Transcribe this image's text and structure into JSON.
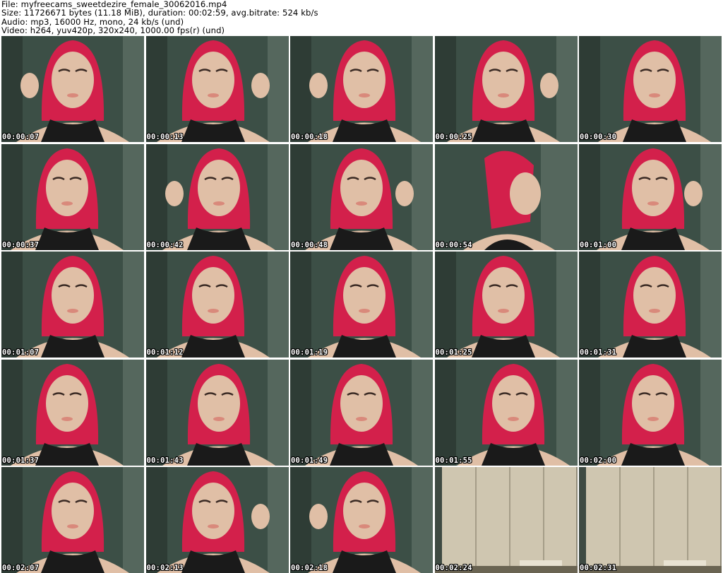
{
  "header": {
    "file_line": "File: myfreecams_sweetdezire_female_30062016.mp4",
    "size_line": "Size: 11726671 bytes (11.18 MiB), duration: 00:02:59, avg.bitrate: 524 kb/s",
    "audio_line": "Audio: mp3, 16000 Hz, mono, 24 kb/s (und)",
    "video_line": "Video: h264, yuv420p, 320x240, 1000.00 fps(r) (und)"
  },
  "colors": {
    "background": "#ffffff",
    "timestamp_text": "#ffffff",
    "timestamp_outline": "#000000",
    "room_wall": "#3c4f46",
    "hair": "#d3204b",
    "skin": "#e0bfa6",
    "top": "#1a1a1a",
    "wardrobe": "#cfc6b0"
  },
  "thumbnails": [
    {
      "time": "00:00:07",
      "scene": "person-arm-raised-icon"
    },
    {
      "time": "00:00:13",
      "scene": "person-hand-up-icon"
    },
    {
      "time": "00:00:18",
      "scene": "person-hands-on-head-icon"
    },
    {
      "time": "00:00:25",
      "scene": "person-hand-at-cheek-icon"
    },
    {
      "time": "00:00:30",
      "scene": "person-portrait-icon"
    },
    {
      "time": "00:00:37",
      "scene": "person-head-tilted-icon"
    },
    {
      "time": "00:00:42",
      "scene": "person-holding-hair-icon"
    },
    {
      "time": "00:00:48",
      "scene": "person-hand-in-hair-icon"
    },
    {
      "time": "00:00:54",
      "scene": "person-profile-icon"
    },
    {
      "time": "00:01:00",
      "scene": "person-hand-at-chin-icon"
    },
    {
      "time": "00:01:07",
      "scene": "person-portrait-icon"
    },
    {
      "time": "00:01:12",
      "scene": "person-portrait-icon"
    },
    {
      "time": "00:01:19",
      "scene": "person-portrait-icon"
    },
    {
      "time": "00:01:25",
      "scene": "person-portrait-icon"
    },
    {
      "time": "00:01:31",
      "scene": "person-portrait-icon"
    },
    {
      "time": "00:01:37",
      "scene": "person-portrait-icon"
    },
    {
      "time": "00:01:43",
      "scene": "person-portrait-icon"
    },
    {
      "time": "00:01:49",
      "scene": "person-portrait-icon"
    },
    {
      "time": "00:01:55",
      "scene": "person-portrait-icon"
    },
    {
      "time": "00:02:00",
      "scene": "person-portrait-icon"
    },
    {
      "time": "00:02:07",
      "scene": "person-portrait-icon"
    },
    {
      "time": "00:02:13",
      "scene": "person-hand-at-chin-icon"
    },
    {
      "time": "00:02:18",
      "scene": "person-hand-on-head-icon"
    },
    {
      "time": "00:02:24",
      "scene": "empty-room-wardrobe-icon"
    },
    {
      "time": "00:02:31",
      "scene": "empty-room-wardrobe-icon"
    }
  ]
}
